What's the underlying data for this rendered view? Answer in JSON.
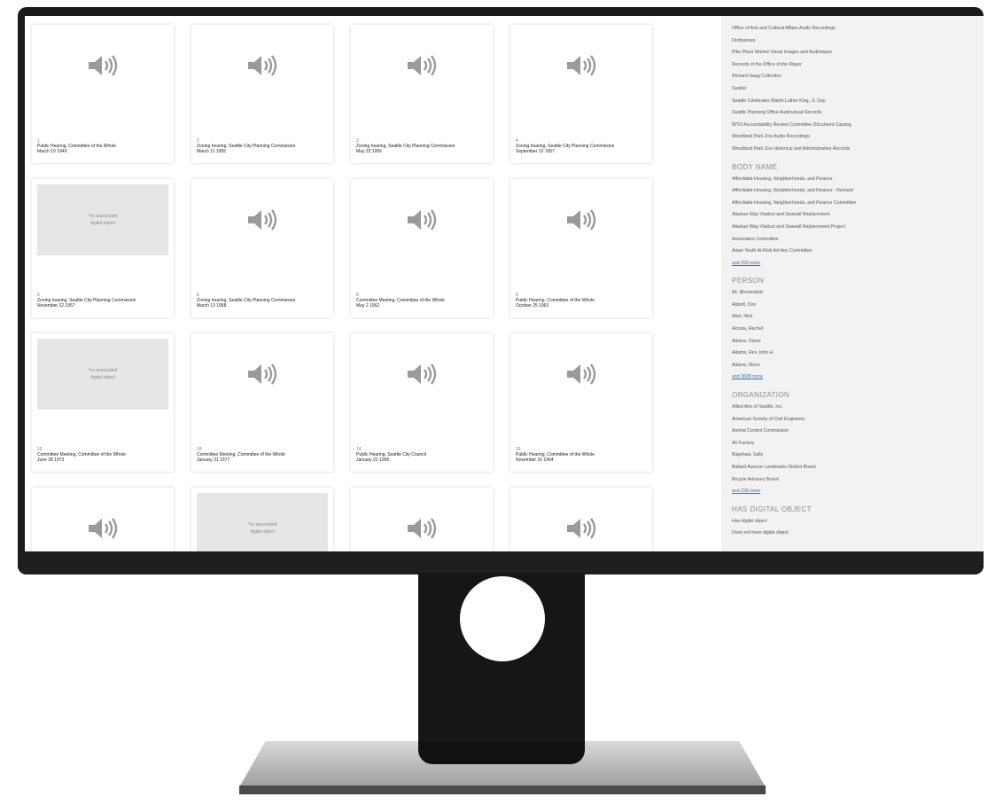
{
  "cards": [
    {
      "num": "1",
      "title": "Public Hearing, Committee of the Whole",
      "date": "March 19 1949",
      "media": "audio"
    },
    {
      "num": "2",
      "title": "Zoning hearing, Seattle City Planning Commission",
      "date": "March 11 1955",
      "media": "audio"
    },
    {
      "num": "3",
      "title": "Zoning hearing, Seattle City Planning Commission",
      "date": "May 23 1956",
      "media": "audio"
    },
    {
      "num": "4",
      "title": "Zoning hearing, Seattle City Planning Commission",
      "date": "September 12 1957",
      "media": "audio"
    },
    {
      "num": "5",
      "title": "Zoning hearing, Seattle City Planning Commission",
      "date": "November 22 1957",
      "media": "none"
    },
    {
      "num": "6",
      "title": "Zoning hearing, Seattle City Planning Commission",
      "date": "March 13 1958",
      "media": "audio"
    },
    {
      "num": "8",
      "title": "Committee Meeting, Committee of the Whole",
      "date": "May 2 1962",
      "media": "audio"
    },
    {
      "num": "9",
      "title": "Public Hearing, Committee of the Whole",
      "date": "October 25 1963",
      "media": "audio"
    },
    {
      "num": "12",
      "title": "Committee Meeting, Committee of the Whole",
      "date": "June 28 1973",
      "media": "none"
    },
    {
      "num": "18",
      "title": "Committee Meeting, Committee of the Whole",
      "date": "January 31 1977",
      "media": "audio"
    },
    {
      "num": "14",
      "title": "Public Hearing, Seattle City Council",
      "date": "January 22 1965",
      "media": "audio"
    },
    {
      "num": "15",
      "title": "Public Hearing, Committee of the Whole",
      "date": "November 16 1964",
      "media": "audio"
    },
    {
      "num": "",
      "title": "",
      "date": "",
      "media": "audio"
    },
    {
      "num": "",
      "title": "",
      "date": "",
      "media": "none"
    },
    {
      "num": "",
      "title": "",
      "date": "",
      "media": "audio"
    },
    {
      "num": "",
      "title": "",
      "date": "",
      "media": "audio"
    }
  ],
  "no_object_text_line1": "*no associated",
  "no_object_text_line2": "digital object",
  "sidebar": {
    "collections": [
      "Office of Arts and Cultural Affairs Audio Recordings",
      "Ordinances",
      "Pike Place Market Visual Images and Audiotapes",
      "Records of the Office of the Mayor",
      "Richard Haag Collection",
      "Seafair",
      "Seattle Celebrates Martin Luther King, Jr. Day",
      "Seattle Planning Office Audiovisual Records",
      "WTO Accountability Review Committee Document Catalog",
      "Woodland Park Zoo Audio Recordings",
      "Woodland Park Zoo Historical and Administrative Records"
    ],
    "body_name": {
      "heading": "BODY NAME",
      "items": [
        "Affordable Housing, Neighborhoods, and Finance",
        "Affordable Housing, Neighborhoods, and Finance - Revised",
        "Affordable Housing, Neighborhoods, and Finance Committee",
        "Alaskan Way Viaduct and Seawall Replacement",
        "Alaskan Way Viaduct and Seawall Replacement Project",
        "Annexation Committee",
        "Asian Youth At-Risk Ad-Hoc Committee"
      ],
      "more": "and 293 more"
    },
    "person": {
      "heading": "PERSON",
      "items": [
        "Mr. Blomenfeld",
        "Abbott, Don",
        "Abel, Nick",
        "Acosta, Rachel",
        "Adams, Diane",
        "Adams, Rev John H",
        "Adams, Moss"
      ],
      "more": "and 3608 more"
    },
    "organization": {
      "heading": "ORGANIZATION",
      "items": [
        "Allied Arts of Seattle, Inc.",
        "American Society of Civil Engineers",
        "Animal Control Commission",
        "AV Factory",
        "Bagshaw, Sally",
        "Ballard Avenue Landmarks District Board",
        "Bicycle Advisory Board"
      ],
      "more": "and 228 more"
    },
    "digital_object": {
      "heading": "HAS DIGITAL OBJECT",
      "items": [
        "Has digital object",
        "Does not have digital object"
      ]
    }
  }
}
